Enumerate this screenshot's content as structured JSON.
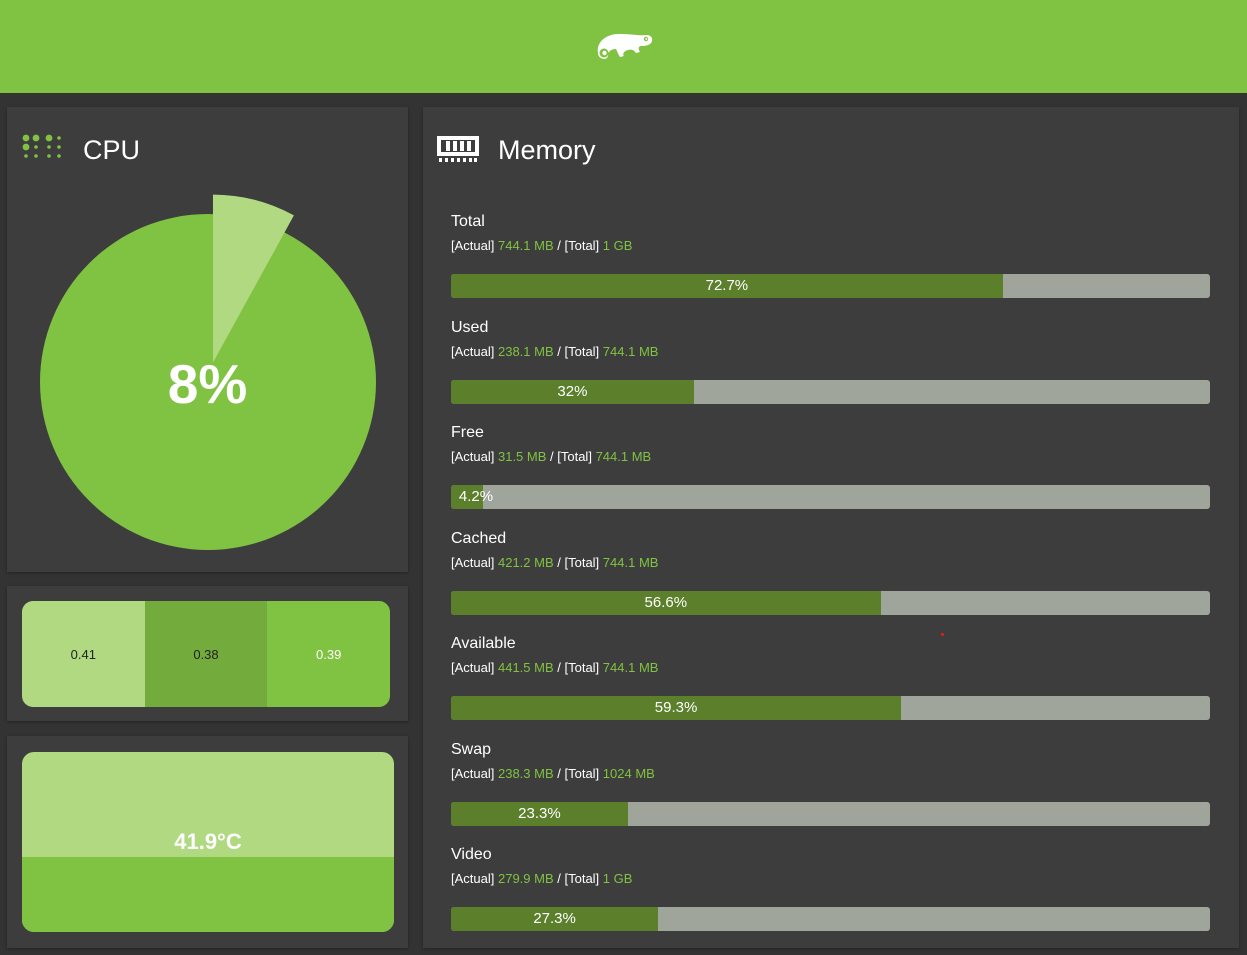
{
  "header": {
    "logo_icon": "chameleon-logo-icon",
    "accent_color": "#80c241"
  },
  "cpu": {
    "title": "CPU",
    "icon": "cpu-icon",
    "usage_percent": 8,
    "usage_label": "8%"
  },
  "load": {
    "values": [
      {
        "value": "0.41"
      },
      {
        "value": "0.38"
      },
      {
        "value": "0.39"
      }
    ]
  },
  "temperature": {
    "label": "41.9°C"
  },
  "memory": {
    "title": "Memory",
    "icon": "memory-icon",
    "items": [
      {
        "name": "Total",
        "actual_label": "[Actual]",
        "actual": "744.1 MB",
        "total_label": "[Total]",
        "total": "1 GB",
        "percent": 72.7,
        "percent_label": "72.7%"
      },
      {
        "name": "Used",
        "actual_label": "[Actual]",
        "actual": "238.1 MB",
        "total_label": "[Total]",
        "total": "744.1 MB",
        "percent": 32,
        "percent_label": "32%"
      },
      {
        "name": "Free",
        "actual_label": "[Actual]",
        "actual": "31.5 MB",
        "total_label": "[Total]",
        "total": "744.1 MB",
        "percent": 4.2,
        "percent_label": "4.2%"
      },
      {
        "name": "Cached",
        "actual_label": "[Actual]",
        "actual": "421.2 MB",
        "total_label": "[Total]",
        "total": "744.1 MB",
        "percent": 56.6,
        "percent_label": "56.6%"
      },
      {
        "name": "Available",
        "actual_label": "[Actual]",
        "actual": "441.5 MB",
        "total_label": "[Total]",
        "total": "744.1 MB",
        "percent": 59.3,
        "percent_label": "59.3%"
      },
      {
        "name": "Swap",
        "actual_label": "[Actual]",
        "actual": "238.3 MB",
        "total_label": "[Total]",
        "total": "1024 MB",
        "percent": 23.3,
        "percent_label": "23.3%"
      },
      {
        "name": "Video",
        "actual_label": "[Actual]",
        "actual": "279.9 MB",
        "total_label": "[Total]",
        "total": "1 GB",
        "percent": 27.3,
        "percent_label": "27.3%"
      }
    ]
  }
}
